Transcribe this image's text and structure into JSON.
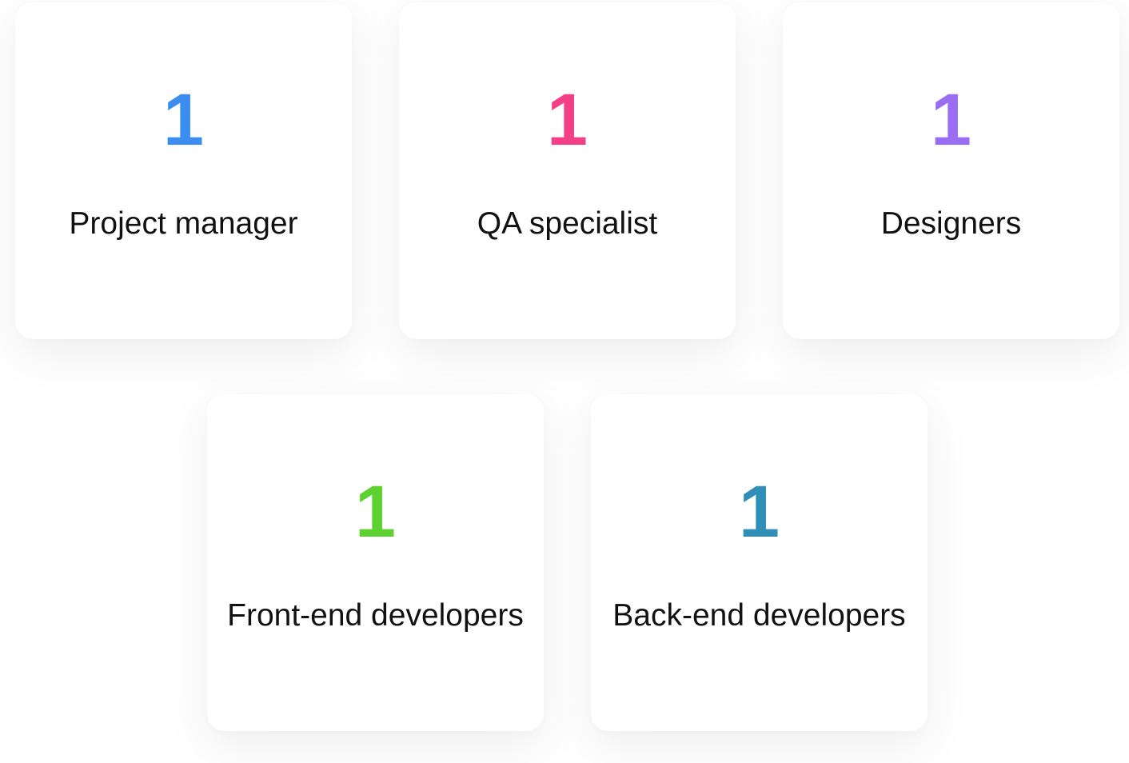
{
  "team": [
    {
      "count": "1",
      "label": "Project manager",
      "color": "#3B8EF0"
    },
    {
      "count": "1",
      "label": "QA specialist",
      "color": "#F23F86"
    },
    {
      "count": "1",
      "label": "Designers",
      "color": "#9A6DF2"
    },
    {
      "count": "1",
      "label": "Front-end developers",
      "color": "#5DD12F"
    },
    {
      "count": "1",
      "label": "Back-end developers",
      "color": "#2F8FB7"
    }
  ]
}
